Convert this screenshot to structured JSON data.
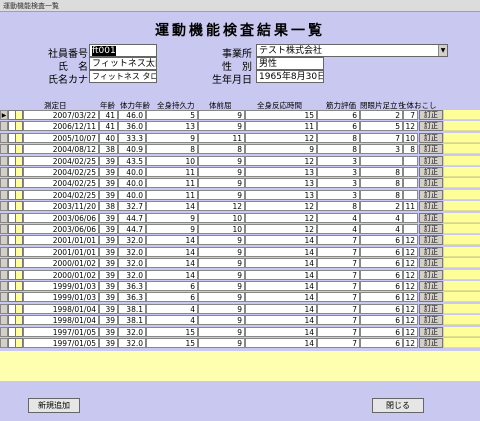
{
  "window": {
    "title": "運動機能検査一覧"
  },
  "heading": "運動機能検査結果一覧",
  "employee": {
    "id_label": "社員番号",
    "id_value": "ft001",
    "name_label": "氏　名",
    "name_value": "フィットネス太郎",
    "kana_label": "氏名カナ",
    "kana_value": "フィットネス タロウ",
    "office_label": "事業所",
    "office_value": "テスト株式会社",
    "gender_label": "性　別",
    "gender_value": "男性",
    "birth_label": "生年月日",
    "birth_value": "1965年8月30日"
  },
  "columns": [
    "測定日",
    "年齢",
    "体力年齢",
    "全身持久力",
    "体前屈",
    "全身反応時間",
    "筋力評価",
    "閉眼片足立ち",
    "上体おこし"
  ],
  "edit_label": "訂正",
  "rows": [
    [
      "2007/03/22",
      "41",
      "46.0",
      "5",
      "9",
      "15",
      "6",
      "2",
      "7"
    ],
    [
      "2006/12/11",
      "41",
      "36.0",
      "13",
      "9",
      "11",
      "6",
      "5",
      "12"
    ],
    [
      "2005/10/07",
      "40",
      "33.3",
      "9",
      "11",
      "12",
      "8",
      "7",
      "10"
    ],
    [
      "2004/08/12",
      "38",
      "40.9",
      "8",
      "8",
      "9",
      "8",
      "3",
      "8"
    ],
    [
      "2004/02/25",
      "39",
      "43.5",
      "10",
      "9",
      "12",
      "3",
      "",
      ""
    ],
    [
      "2004/02/25",
      "39",
      "40.0",
      "11",
      "9",
      "13",
      "3",
      "8",
      ""
    ],
    [
      "2004/02/25",
      "39",
      "40.0",
      "11",
      "9",
      "13",
      "3",
      "8",
      ""
    ],
    [
      "2004/02/25",
      "39",
      "40.0",
      "11",
      "9",
      "13",
      "3",
      "8",
      ""
    ],
    [
      "2003/11/20",
      "38",
      "32.7",
      "14",
      "12",
      "12",
      "8",
      "2",
      "11"
    ],
    [
      "2003/06/06",
      "39",
      "44.7",
      "9",
      "10",
      "12",
      "4",
      "4",
      ""
    ],
    [
      "2003/06/06",
      "39",
      "44.7",
      "9",
      "10",
      "12",
      "4",
      "4",
      ""
    ],
    [
      "2001/01/01",
      "39",
      "32.0",
      "14",
      "9",
      "14",
      "7",
      "6",
      "12"
    ],
    [
      "2001/01/01",
      "39",
      "32.0",
      "14",
      "9",
      "14",
      "7",
      "6",
      "12"
    ],
    [
      "2000/01/02",
      "39",
      "32.0",
      "14",
      "9",
      "14",
      "7",
      "6",
      "12"
    ],
    [
      "2000/01/02",
      "39",
      "32.0",
      "14",
      "9",
      "14",
      "7",
      "6",
      "12"
    ],
    [
      "1999/01/03",
      "39",
      "36.3",
      "6",
      "9",
      "14",
      "7",
      "6",
      "12"
    ],
    [
      "1999/01/03",
      "39",
      "36.3",
      "6",
      "9",
      "14",
      "7",
      "6",
      "12"
    ],
    [
      "1998/01/04",
      "39",
      "38.1",
      "4",
      "9",
      "14",
      "7",
      "6",
      "12"
    ],
    [
      "1998/01/04",
      "39",
      "38.1",
      "4",
      "9",
      "14",
      "7",
      "6",
      "12"
    ],
    [
      "1997/01/05",
      "39",
      "32.0",
      "15",
      "9",
      "14",
      "7",
      "6",
      "12"
    ],
    [
      "1997/01/05",
      "39",
      "32.0",
      "15",
      "9",
      "14",
      "7",
      "6",
      "12"
    ]
  ],
  "current_row_marker": "▶",
  "footer": {
    "add_label": "新規追加",
    "close_label": "閉じる"
  }
}
